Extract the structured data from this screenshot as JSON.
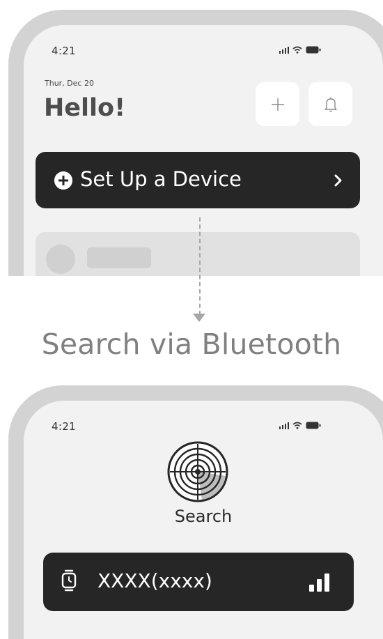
{
  "top_screen": {
    "status_time": "4:21",
    "date": "Thur, Dec 20",
    "greeting": "Hello!",
    "setup_label": "Set Up a Device"
  },
  "flow_caption": "Search via Bluetooth",
  "bottom_screen": {
    "status_time": "4:21",
    "search_label": "Search",
    "device_name": "XXXX(xxxx)"
  },
  "icons": {
    "add": "plus-icon",
    "notifications": "bell-icon",
    "setup": "plus-circle-icon",
    "chevron": "chevron-right-icon",
    "radar": "radar-icon",
    "device": "watch-icon",
    "signal": "signal-strength-icon"
  },
  "colors": {
    "dark_bar": "#262626",
    "screen_bg": "#f2f2f2",
    "frame": "#d3d3d3",
    "caption": "#808080"
  }
}
